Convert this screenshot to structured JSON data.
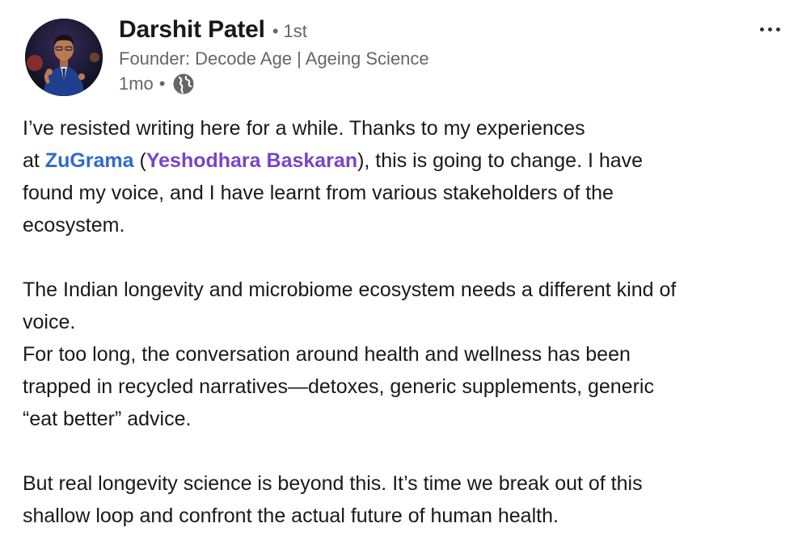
{
  "author": {
    "name": "Darshit Patel",
    "separator": "•",
    "degree": "1st",
    "headline": "Founder: Decode Age | Ageing Science",
    "timestamp": "1mo",
    "meta_separator": "•",
    "visibility_icon": "globe-icon"
  },
  "menu": {
    "icon": "more-options-icon"
  },
  "post": {
    "p1": {
      "line1": "I’ve resisted writing here for a while. Thanks to my experiences",
      "line2_prefix": "at ",
      "mention_org": "ZuGrama",
      "open_paren": " (",
      "mention_person": "Yeshodhara Baskaran",
      "line2_suffix": "), this is going to change. I have",
      "line3": "found my voice, and I have learnt from various stakeholders of the",
      "line4": "ecosystem."
    },
    "p2": {
      "line1": "The Indian longevity and microbiome ecosystem needs a different kind of",
      "line2": "voice.",
      "line3": "For too long, the conversation around health and wellness has been",
      "line4": "trapped in recycled narratives—detoxes, generic supplements, generic",
      "line5": "“eat better” advice."
    },
    "p3": {
      "line1": "But real longevity science is beyond this. It’s time we break out of this",
      "line2": "shallow loop and confront the actual future of human health."
    }
  },
  "colors": {
    "org_mention": "#2f6bcb",
    "person_mention": "#7a43c9",
    "text": "#191919",
    "secondary": "#666666"
  }
}
